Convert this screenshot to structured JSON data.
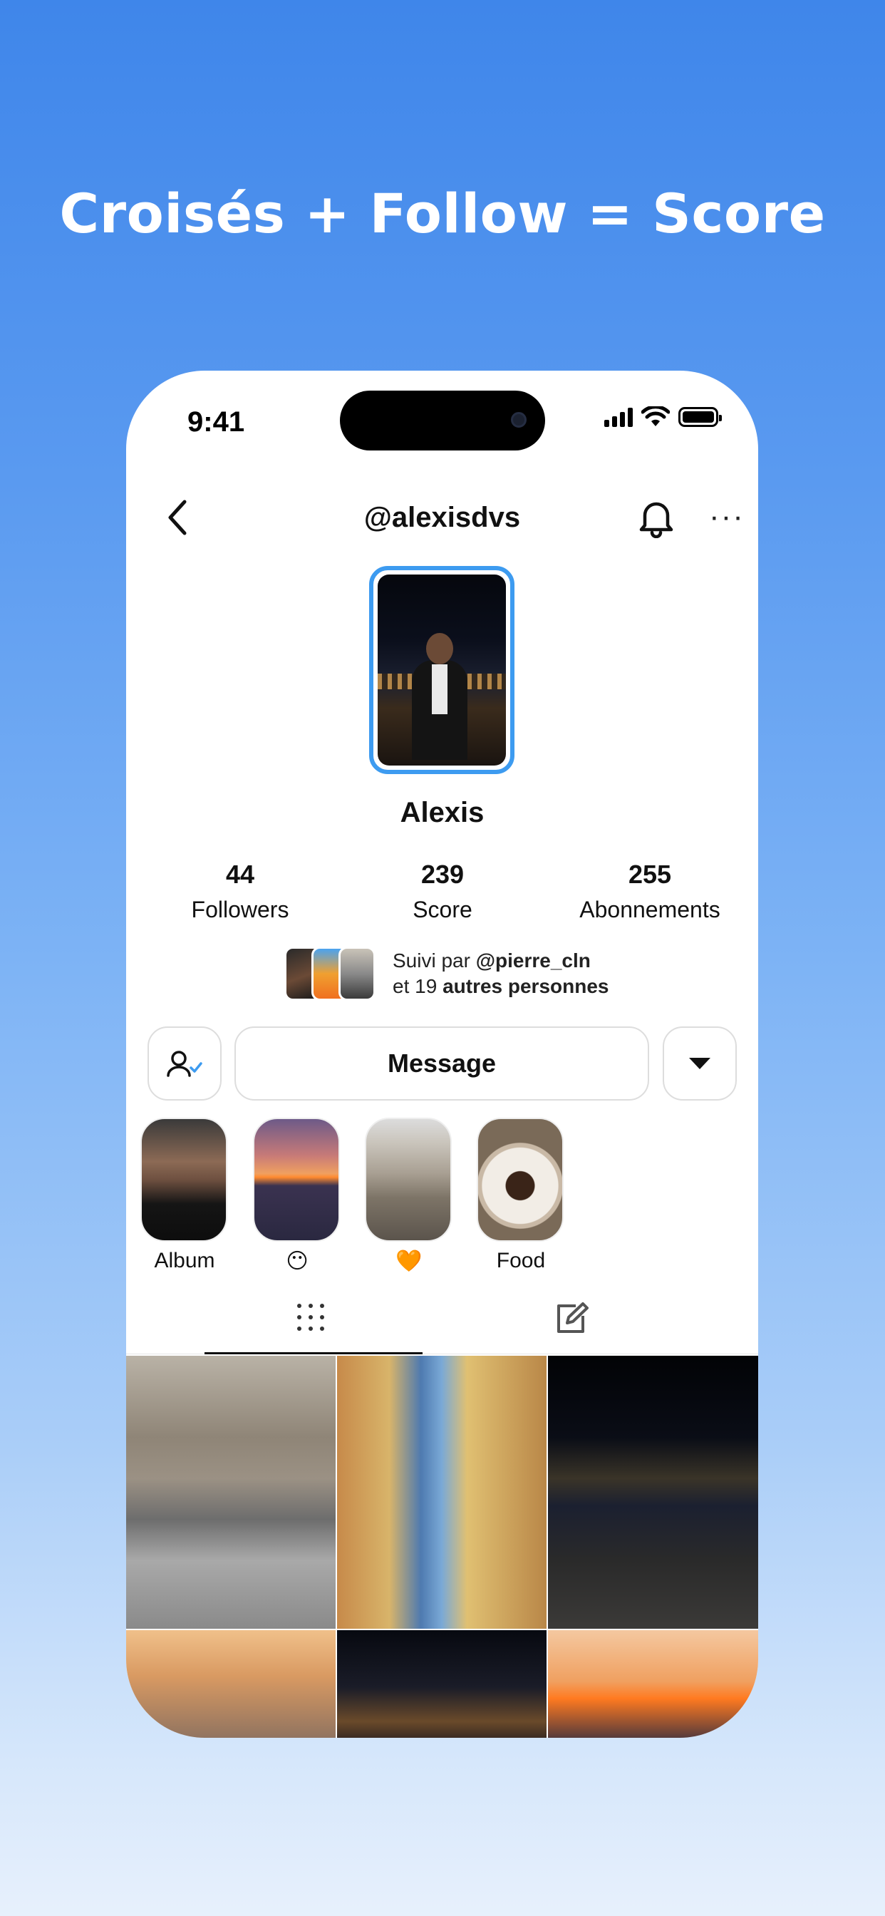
{
  "headline": "Croisés + Follow = Score",
  "status_bar": {
    "time": "9:41"
  },
  "header": {
    "username": "@alexisdvs",
    "more": "···"
  },
  "profile": {
    "name": "Alexis"
  },
  "stats": [
    {
      "value": "44",
      "label": "Followers"
    },
    {
      "value": "239",
      "label": "Score"
    },
    {
      "value": "255",
      "label": "Abonnements"
    }
  ],
  "followed_by": {
    "prefix": "Suivi par",
    "user": "@pierre_cln",
    "and": "et 19",
    "others": "autres personnes"
  },
  "actions": {
    "message": "Message"
  },
  "highlights": [
    {
      "caption": "Album"
    },
    {
      "caption": "😶"
    },
    {
      "caption": "🧡"
    },
    {
      "caption": "Food"
    }
  ],
  "tabs": {
    "grid_icon": "grid-icon",
    "edit_icon": "edit-icon",
    "active": "grid"
  },
  "colors": {
    "accent": "#3d9bf0",
    "background_top": "#3f86ea",
    "background_bottom": "#e7f0fc"
  }
}
